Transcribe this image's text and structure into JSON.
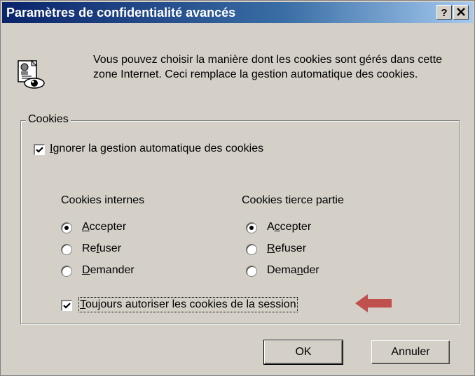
{
  "window": {
    "title": "Paramètres de confidentialité avancés",
    "help_label": "?",
    "close_label": "✕"
  },
  "intro": {
    "text": "Vous pouvez choisir la manière dont les cookies sont gérés dans cette zone Internet. Ceci remplace la gestion automatique des cookies."
  },
  "cookies_group": {
    "legend": "Cookies",
    "override": {
      "label_prefix": "",
      "label_accel": "I",
      "label_rest": "gnorer la gestion automatique des cookies",
      "checked": true
    },
    "first_party": {
      "heading": "Cookies internes",
      "options": [
        {
          "pre": "",
          "accel": "A",
          "post": "ccepter",
          "selected": true
        },
        {
          "pre": "Re",
          "accel": "f",
          "post": "user",
          "selected": false
        },
        {
          "pre": "",
          "accel": "D",
          "post": "emander",
          "selected": false
        }
      ]
    },
    "third_party": {
      "heading": "Cookies tierce partie",
      "options": [
        {
          "pre": "A",
          "accel": "c",
          "post": "cepter",
          "selected": true
        },
        {
          "pre": "",
          "accel": "R",
          "post": "efuser",
          "selected": false
        },
        {
          "pre": "Dema",
          "accel": "n",
          "post": "der",
          "selected": false
        }
      ]
    },
    "session": {
      "label_prefix": "",
      "label_accel": "T",
      "label_rest": "oujours autoriser les cookies de la session",
      "checked": true
    }
  },
  "buttons": {
    "ok": "OK",
    "cancel": "Annuler"
  },
  "colors": {
    "arrow": "#c0504d",
    "title_bar": "#0a246a"
  }
}
